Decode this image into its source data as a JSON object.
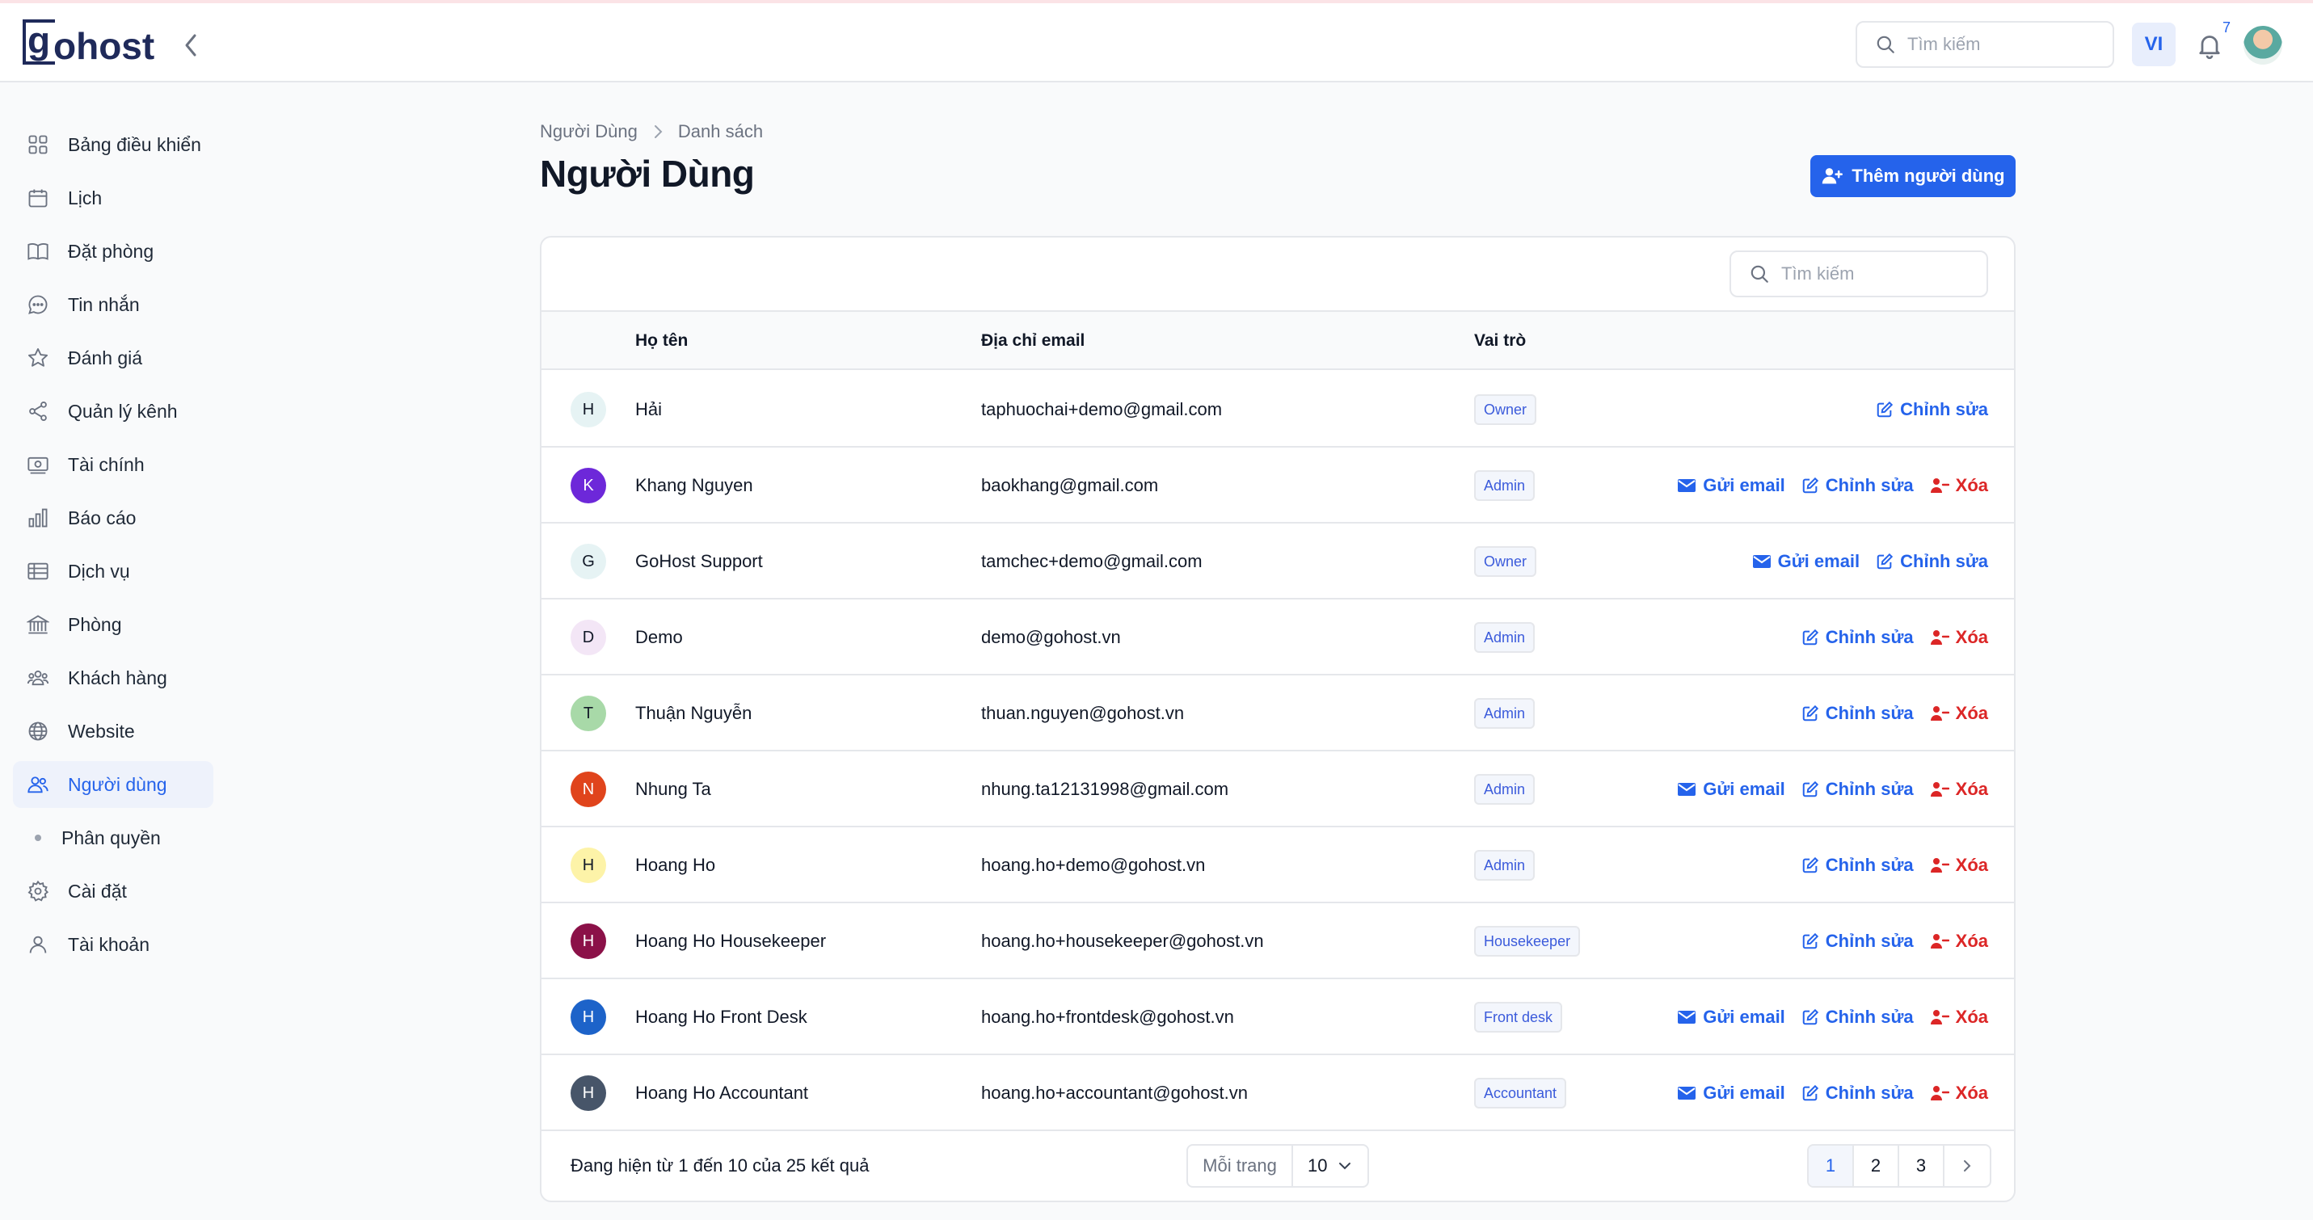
{
  "brand": {
    "logo_g": "g",
    "logo_rest": "ohost"
  },
  "header": {
    "search_placeholder": "Tìm kiếm",
    "language": "VI",
    "notification_count": "7"
  },
  "sidebar": {
    "items": [
      {
        "label": "Bảng điều khiển",
        "icon": "dashboard-icon"
      },
      {
        "label": "Lịch",
        "icon": "calendar-icon"
      },
      {
        "label": "Đặt phòng",
        "icon": "book-icon"
      },
      {
        "label": "Tin nhắn",
        "icon": "chat-icon"
      },
      {
        "label": "Đánh giá",
        "icon": "star-icon"
      },
      {
        "label": "Quản lý kênh",
        "icon": "share-icon"
      },
      {
        "label": "Tài chính",
        "icon": "money-icon"
      },
      {
        "label": "Báo cáo",
        "icon": "bar-chart-icon"
      },
      {
        "label": "Dịch vụ",
        "icon": "table-icon"
      },
      {
        "label": "Phòng",
        "icon": "building-icon"
      },
      {
        "label": "Khách hàng",
        "icon": "customers-icon"
      },
      {
        "label": "Website",
        "icon": "globe-icon"
      },
      {
        "label": "Người dùng",
        "icon": "users-icon",
        "active": true
      },
      {
        "label": "Phân quyền",
        "icon": "dot-icon"
      },
      {
        "label": "Cài đặt",
        "icon": "gear-icon"
      },
      {
        "label": "Tài khoản",
        "icon": "user-icon"
      }
    ]
  },
  "breadcrumb": {
    "parent": "Người Dùng",
    "current": "Danh sách"
  },
  "page": {
    "title": "Người Dùng",
    "add_button": "Thêm người dùng"
  },
  "table": {
    "search_placeholder": "Tìm kiếm",
    "columns": {
      "name": "Họ tên",
      "email": "Địa chỉ email",
      "role": "Vai trò"
    },
    "action_labels": {
      "send_email": "Gửi email",
      "edit": "Chỉnh sửa",
      "delete": "Xóa"
    },
    "rows": [
      {
        "initial": "H",
        "name": "Hải",
        "email": "taphuochai+demo@gmail.com",
        "role": "Owner",
        "avatar_bg": "#e6f3f4",
        "avatar_fg": "#111827",
        "actions": [
          "edit"
        ]
      },
      {
        "initial": "K",
        "name": "Khang Nguyen",
        "email": "baokhang@gmail.com",
        "role": "Admin",
        "avatar_bg": "#6d28d9",
        "avatar_fg": "#ffffff",
        "actions": [
          "send_email",
          "edit",
          "delete"
        ]
      },
      {
        "initial": "G",
        "name": "GoHost Support",
        "email": "tamchec+demo@gmail.com",
        "role": "Owner",
        "avatar_bg": "#e6f3f4",
        "avatar_fg": "#111827",
        "actions": [
          "send_email",
          "edit"
        ]
      },
      {
        "initial": "D",
        "name": "Demo",
        "email": "demo@gohost.vn",
        "role": "Admin",
        "avatar_bg": "#f3e6f6",
        "avatar_fg": "#111827",
        "actions": [
          "edit",
          "delete"
        ]
      },
      {
        "initial": "T",
        "name": "Thuận Nguyễn",
        "email": "thuan.nguyen@gohost.vn",
        "role": "Admin",
        "avatar_bg": "#a8d9a8",
        "avatar_fg": "#111827",
        "actions": [
          "edit",
          "delete"
        ]
      },
      {
        "initial": "N",
        "name": "Nhung Ta",
        "email": "nhung.ta12131998@gmail.com",
        "role": "Admin",
        "avatar_bg": "#e0441c",
        "avatar_fg": "#ffffff",
        "actions": [
          "send_email",
          "edit",
          "delete"
        ]
      },
      {
        "initial": "H",
        "name": "Hoang Ho",
        "email": "hoang.ho+demo@gohost.vn",
        "role": "Admin",
        "avatar_bg": "#fdf3a8",
        "avatar_fg": "#111827",
        "actions": [
          "edit",
          "delete"
        ]
      },
      {
        "initial": "H",
        "name": "Hoang Ho Housekeeper",
        "email": "hoang.ho+housekeeper@gohost.vn",
        "role": "Housekeeper",
        "avatar_bg": "#8b1148",
        "avatar_fg": "#ffffff",
        "actions": [
          "edit",
          "delete"
        ]
      },
      {
        "initial": "H",
        "name": "Hoang Ho Front Desk",
        "email": "hoang.ho+frontdesk@gohost.vn",
        "role": "Front desk",
        "avatar_bg": "#1d63c9",
        "avatar_fg": "#ffffff",
        "actions": [
          "send_email",
          "edit",
          "delete"
        ]
      },
      {
        "initial": "H",
        "name": "Hoang Ho Accountant",
        "email": "hoang.ho+accountant@gohost.vn",
        "role": "Accountant",
        "avatar_bg": "#475569",
        "avatar_fg": "#ffffff",
        "actions": [
          "send_email",
          "edit",
          "delete"
        ]
      }
    ]
  },
  "footer": {
    "summary": "Đang hiện từ 1 đến 10 của 25 kết quả",
    "per_page_label": "Mỗi trang",
    "per_page_value": "10",
    "pages": [
      "1",
      "2",
      "3"
    ],
    "current_page": "1"
  },
  "colors": {
    "accent": "#2563eb",
    "danger": "#dc2626",
    "brand": "#1f2a5a"
  }
}
